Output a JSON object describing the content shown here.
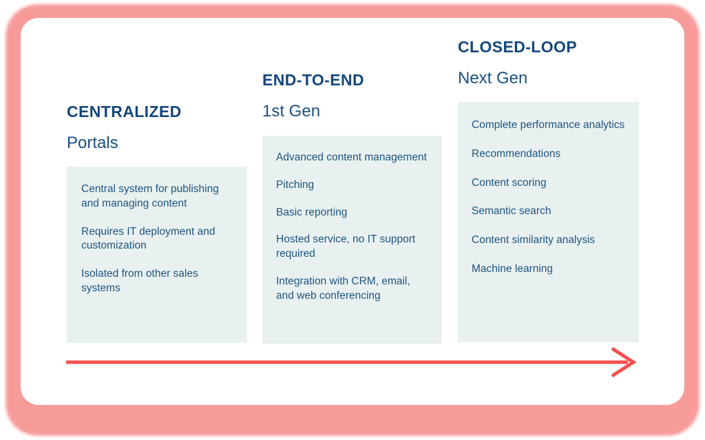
{
  "diagram": {
    "title_hidden": "",
    "accent_frame_color": "#f79a99",
    "box_fill_color": "#e9f1f0",
    "heading_color": "#14477b",
    "body_text_color": "#1e5580",
    "arrow_color": "#f4514e",
    "columns": [
      {
        "heading": "CENTRALIZED",
        "subtitle": "Portals",
        "items": [
          "Central system for publishing and managing content",
          "Requires IT deployment and customization",
          "Isolated from other sales systems"
        ]
      },
      {
        "heading": "END-TO-END",
        "subtitle": "1st Gen",
        "items": [
          "Advanced content management",
          "Pitching",
          "Basic reporting",
          "Hosted service, no IT support required",
          "Integration with CRM, email, and web conferencing"
        ]
      },
      {
        "heading": "CLOSED-LOOP",
        "subtitle": "Next Gen",
        "items": [
          "Complete performance analytics",
          "Recommendations",
          "Content scoring",
          "Semantic search",
          "Content similarity analysis",
          "Machine learning"
        ]
      }
    ],
    "arrow": {
      "name": "progression-arrow",
      "direction": "right"
    }
  }
}
